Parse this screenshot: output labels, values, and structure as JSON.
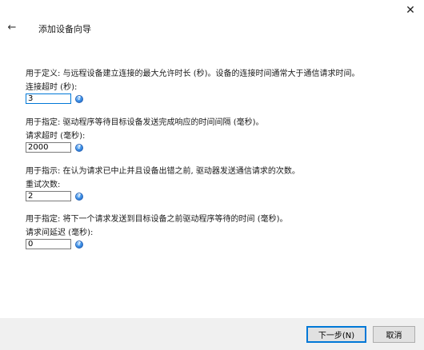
{
  "window": {
    "close_glyph": "✕"
  },
  "header": {
    "back_glyph": "←",
    "title": "添加设备向导"
  },
  "fields": [
    {
      "description": "用于定义: 与远程设备建立连接的最大允许时长 (秒)。设备的连接时间通常大于通信请求时间。",
      "label": "连接超时 (秒):",
      "value": "3"
    },
    {
      "description": "用于指定: 驱动程序等待目标设备发送完成响应的时间间隔 (毫秒)。",
      "label": "请求超时 (毫秒):",
      "value": "2000"
    },
    {
      "description": "用于指示: 在认为请求已中止并且设备出错之前, 驱动器发送通信请求的次数。",
      "label": "重试次数:",
      "value": "2"
    },
    {
      "description": "用于指定: 将下一个请求发送到目标设备之前驱动程序等待的时间 (毫秒)。",
      "label": "请求间延迟 (毫秒):",
      "value": "0"
    }
  ],
  "help_icon": {
    "name": "help-icon",
    "glyph": "?",
    "color": "#3a8ee6"
  },
  "footer": {
    "next_label": "下一步(N)",
    "cancel_label": "取消"
  },
  "colors": {
    "accent": "#0078d7",
    "footer_bg": "#f0f0f0"
  }
}
